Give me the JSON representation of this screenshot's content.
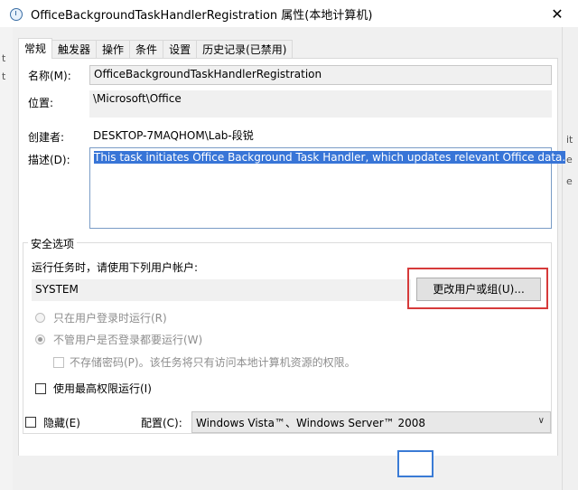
{
  "window": {
    "title": "OfficeBackgroundTaskHandlerRegistration 属性(本地计算机)",
    "close_glyph": "✕"
  },
  "tabs": [
    {
      "label": "常规",
      "active": true
    },
    {
      "label": "触发器",
      "active": false
    },
    {
      "label": "操作",
      "active": false
    },
    {
      "label": "条件",
      "active": false
    },
    {
      "label": "设置",
      "active": false
    },
    {
      "label": "历史记录(已禁用)",
      "active": false
    }
  ],
  "general": {
    "name_label": "名称(M):",
    "name_value": "OfficeBackgroundTaskHandlerRegistration",
    "location_label": "位置:",
    "location_value": "\\Microsoft\\Office",
    "author_label": "创建者:",
    "author_value": "DESKTOP-7MAQHOM\\Lab-段锐",
    "description_label": "描述(D):",
    "description_value": "This task initiates Office Background Task Handler, which updates relevant Office data."
  },
  "security": {
    "group_title": "安全选项",
    "run_as_label": "运行任务时，请使用下列用户帐户:",
    "account_value": "SYSTEM",
    "change_user_button": "更改用户或组(U)...",
    "radio_logged_on": "只在用户登录时运行(R)",
    "radio_whether": "不管用户是否登录都要运行(W)",
    "no_store_password": "不存储密码(P)。该任务将只有访问本地计算机资源的权限。",
    "highest_privileges": "使用最高权限运行(I)"
  },
  "bottom": {
    "hidden_label": "隐藏(E)",
    "configure_label": "配置(C):",
    "configure_value": "Windows Vista™、Windows Server™ 2008"
  },
  "edge_fragments": {
    "left": [
      "t",
      "t"
    ],
    "right": [
      "it",
      "e",
      "e"
    ]
  },
  "colors": {
    "selection": "#3875d7",
    "highlight_box": "#d63a3a",
    "panel_bg": "#ffffff",
    "dialog_bg": "#f0f0f0"
  }
}
